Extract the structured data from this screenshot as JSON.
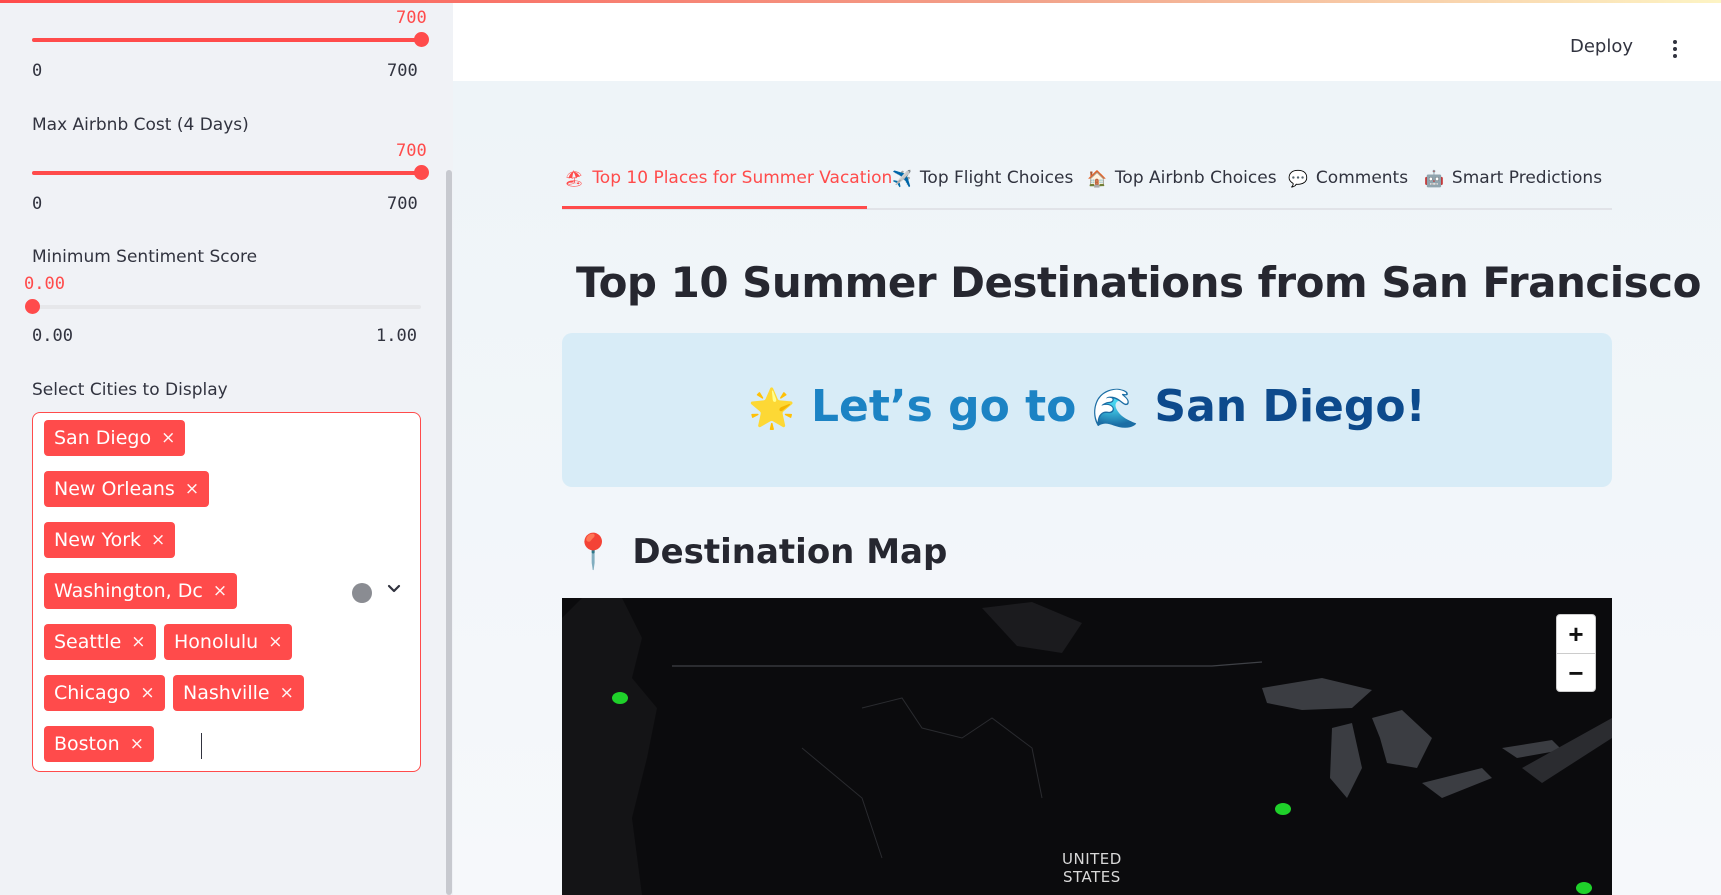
{
  "sidebar": {
    "flight_slider": {
      "value": "700",
      "min": "0",
      "max": "700",
      "fraction": 1.0
    },
    "airbnb_slider": {
      "label": "Max Airbnb Cost (4 Days)",
      "value": "700",
      "min": "0",
      "max": "700",
      "fraction": 1.0
    },
    "sentiment_slider": {
      "label": "Minimum Sentiment Score",
      "value": "0.00",
      "min": "0.00",
      "max": "1.00",
      "fraction": 0.0
    },
    "cities": {
      "label": "Select Cities to Display",
      "selected": [
        "San Diego",
        "New Orleans",
        "New York",
        "Washington, Dc",
        "Seattle",
        "Honolulu",
        "Chicago",
        "Nashville",
        "Boston"
      ],
      "remove_glyph": "×"
    }
  },
  "header": {
    "deploy_label": "Deploy"
  },
  "tabs": [
    {
      "icon": "🏖",
      "label": "Top 10 Places for Summer Vacation",
      "active": true
    },
    {
      "icon": "✈️",
      "label": "Top Flight Choices",
      "active": false
    },
    {
      "icon": "🏠",
      "label": "Top Airbnb Choices",
      "active": false
    },
    {
      "icon": "💬",
      "label": "Comments",
      "active": false
    },
    {
      "icon": "🤖",
      "label": "Smart Predictions",
      "active": false
    }
  ],
  "main": {
    "title": "Top 10 Summer Destinations from San Francisco",
    "banner": {
      "emoji_left": "🌟",
      "prefix": "Let’s go to",
      "emoji_wave": "🌊",
      "city": "San Diego!"
    },
    "map_heading_icon": "📍",
    "map_heading": "Destination Map",
    "map": {
      "zoom_in": "+",
      "zoom_out": "−",
      "country_label_1": "UNITED",
      "country_label_2": "STATES"
    }
  },
  "colors": {
    "accent": "#ff4b4b",
    "banner_bg": "#d8ecf7",
    "banner_text": "#1c83c4",
    "marker": "#1fd12a"
  }
}
